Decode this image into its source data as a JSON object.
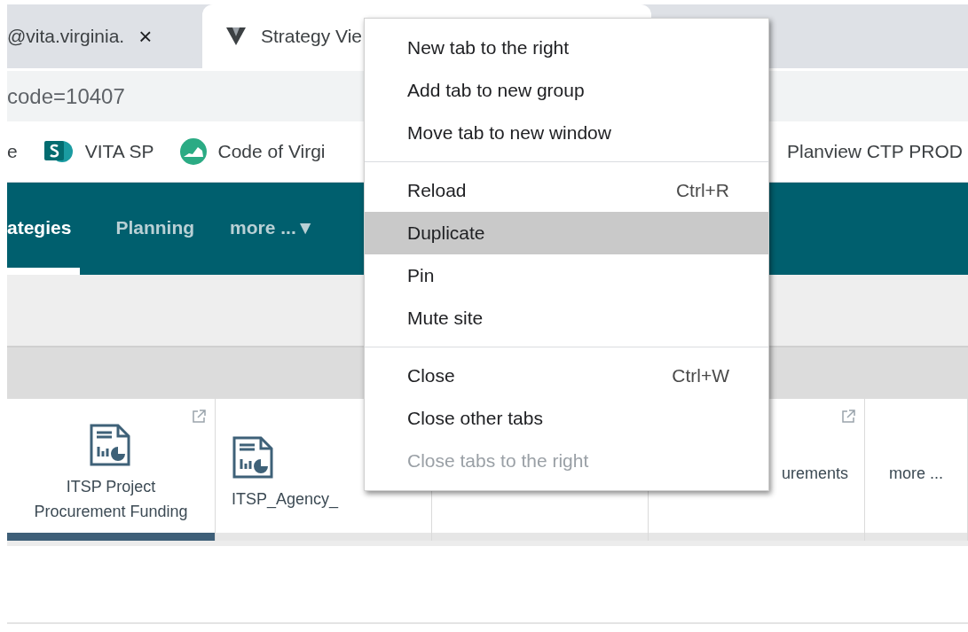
{
  "browser_tabs": [
    {
      "title": "@vita.virginia.",
      "selected": false,
      "close": "×"
    },
    {
      "title": "Strategy Vie",
      "selected": true
    }
  ],
  "address_bar": {
    "value": "code=10407"
  },
  "bookmarks": [
    {
      "label": "e"
    },
    {
      "label": "VITA SP"
    },
    {
      "label": "Code of Virgi"
    },
    {
      "label": "Planview CTP PROD"
    }
  ],
  "nav": [
    {
      "label": "ategies",
      "selected": true
    },
    {
      "label": "Planning",
      "selected": false
    },
    {
      "label": "more ...▼",
      "selected": false
    }
  ],
  "tiles": [
    {
      "label": "ITSP Project Procurement Funding",
      "selected": true
    },
    {
      "label": "ITSP_Agency_",
      "selected": false
    },
    {
      "selected": false
    },
    {
      "label": "urements",
      "selected": false
    },
    {
      "label": "more ...",
      "selected": false
    }
  ],
  "context_menu": [
    {
      "kind": "item",
      "label": "New tab to the right",
      "selected": false,
      "disabled": false
    },
    {
      "kind": "item",
      "label": "Add tab to new group",
      "selected": false,
      "disabled": false
    },
    {
      "kind": "item",
      "label": "Move tab to new window",
      "selected": false,
      "disabled": false
    },
    {
      "kind": "separator"
    },
    {
      "kind": "item",
      "label": "Reload",
      "shortcut": "Ctrl+R",
      "selected": false,
      "disabled": false
    },
    {
      "kind": "item",
      "label": "Duplicate",
      "selected": true,
      "disabled": false
    },
    {
      "kind": "item",
      "label": "Pin",
      "selected": false,
      "disabled": false
    },
    {
      "kind": "item",
      "label": "Mute site",
      "selected": false,
      "disabled": false
    },
    {
      "kind": "separator"
    },
    {
      "kind": "item",
      "label": "Close",
      "shortcut": "Ctrl+W",
      "selected": false,
      "disabled": false
    },
    {
      "kind": "item",
      "label": "Close other tabs",
      "selected": false,
      "disabled": false
    },
    {
      "kind": "item",
      "label": "Close tabs to the right",
      "selected": false,
      "disabled": true
    }
  ]
}
